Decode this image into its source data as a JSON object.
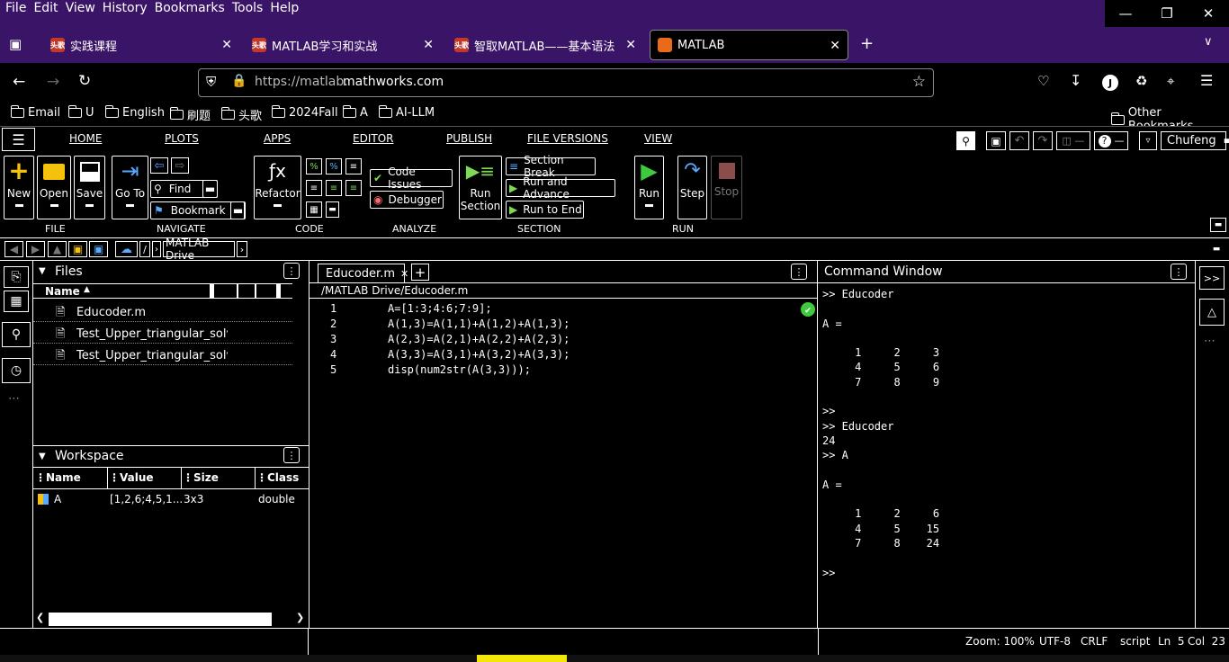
{
  "browser": {
    "menu": [
      "File",
      "Edit",
      "View",
      "History",
      "Bookmarks",
      "Tools",
      "Help"
    ],
    "tabs": [
      {
        "label": "实践课程",
        "fav": "头歌"
      },
      {
        "label": "MATLAB学习和实战",
        "fav": "头歌"
      },
      {
        "label": "智取MATLAB——基本语法",
        "fav": "头歌"
      },
      {
        "label": "MATLAB",
        "fav": ""
      }
    ],
    "url_prefix": "https://matlab.",
    "url_domain": "mathworks.com",
    "url_suffix": ".com",
    "profile_initial": "J",
    "bookmarks": [
      "Email",
      "U",
      "English",
      "刷题",
      "头歌",
      "2024Fall",
      "A",
      "AI-LLM"
    ],
    "other_bookmarks": "Other Bookmarks"
  },
  "matlab": {
    "tabs": [
      "HOME",
      "PLOTS",
      "APPS",
      "EDITOR",
      "PUBLISH",
      "FILE VERSIONS",
      "VIEW"
    ],
    "user": "Chufeng",
    "toolbar": {
      "new": "New",
      "open": "Open",
      "save": "Save",
      "goto": "Go To",
      "find": "Find",
      "bookmark": "Bookmark",
      "refactor": "Refactor",
      "code_issues": "Code Issues",
      "debugger": "Debugger",
      "run_section": "Run Section",
      "section_break": "Section Break",
      "run_advance": "Run and Advance",
      "run_to_end": "Run to End",
      "run": "Run",
      "step": "Step",
      "stop": "Stop",
      "sections": [
        "FILE",
        "NAVIGATE",
        "CODE",
        "ANALYZE",
        "SECTION",
        "RUN"
      ]
    },
    "address": {
      "root": "/",
      "folder": "MATLAB Drive"
    },
    "files": {
      "title": "Files",
      "col_name": "Name",
      "items": [
        "Educoder.m",
        "Test_Upper_triangular_solve",
        "Test_Upper_triangular_solve"
      ]
    },
    "workspace": {
      "title": "Workspace",
      "cols": [
        "Name",
        "Value",
        "Size",
        "Class"
      ],
      "rows": [
        {
          "name": "A",
          "value": "[1,2,6;4,5,1...",
          "size": "3x3",
          "class": "double"
        }
      ]
    },
    "editor": {
      "tab": "Educoder.m",
      "path": "/MATLAB Drive/Educoder.m",
      "lines": [
        {
          "n": "1",
          "code": "A=[1:3;4:6;7:9];"
        },
        {
          "n": "2",
          "code": "A(1,3)=A(1,1)+A(1,2)+A(1,3);"
        },
        {
          "n": "3",
          "code": "A(2,3)=A(2,1)+A(2,2)+A(2,3);"
        },
        {
          "n": "4",
          "code": "A(3,3)=A(3,1)+A(3,2)+A(3,3);"
        },
        {
          "n": "5",
          "code": "disp(num2str(A(3,3)));"
        }
      ]
    },
    "command": {
      "title": "Command Window",
      "lines": [
        ">> Educoder",
        "",
        "A =",
        "",
        "     1     2     3",
        "     4     5     6",
        "     7     8     9",
        "",
        ">>",
        ">> Educoder",
        "24",
        ">> A",
        "",
        "A =",
        "",
        "     1     2     6",
        "     4     5    15",
        "     7     8    24",
        "",
        ">>"
      ]
    },
    "status": {
      "zoom": "Zoom: 100%",
      "encoding": "UTF-8",
      "eol": "CRLF",
      "type": "script",
      "ln": "Ln  5",
      "col": "Col  23"
    }
  }
}
